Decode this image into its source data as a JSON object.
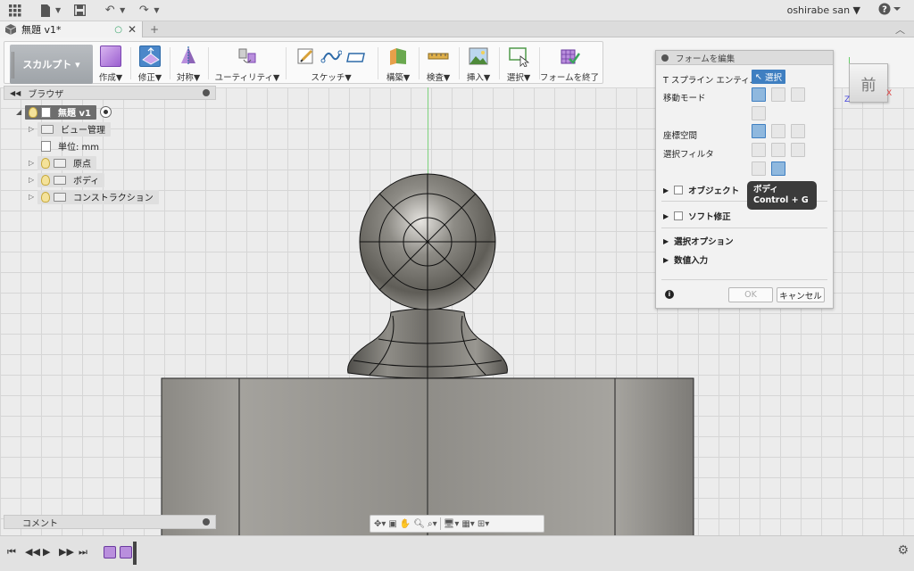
{
  "appbar": {
    "user": "oshirabe san ▼",
    "help": "?"
  },
  "tab": {
    "title": "無題 v1*"
  },
  "toolbar": {
    "workspace": "スカルプト ▾",
    "groups": [
      "作成▼",
      "修正▼",
      "対称▼",
      "ユーティリティ▼",
      "スケッチ▼",
      "構築▼",
      "検査▼",
      "挿入▼",
      "選択▼",
      "フォームを終了"
    ]
  },
  "browser": {
    "title": "ブラウザ",
    "root": "無題 v1",
    "items": [
      "ビュー管理",
      "単位: mm",
      "原点",
      "ボディ",
      "コンストラクション"
    ]
  },
  "comment": {
    "title": "コメント"
  },
  "viewcube": {
    "face": "前",
    "axis_x": "X",
    "axis_z": "Z"
  },
  "dialog": {
    "title": "フォームを編集",
    "t_spline_label": "T スプライン エンティ...",
    "select_button": "選択",
    "move_mode": "移動モード",
    "coord_space": "座標空間",
    "selection_filter": "選択フィルタ",
    "object_section": "オブジェクト",
    "soft_section": "ソフト修正",
    "selection_options": "選択オプション",
    "numeric_input": "数値入力",
    "ok": "OK",
    "cancel": "キャンセル"
  },
  "tooltip": {
    "line1": "ボディ",
    "line2": "Control + G"
  },
  "colors": {
    "accent": "#3f7fc1",
    "workspace_bg": "#a8adb2",
    "tooltip_bg": "#3b3b3b"
  }
}
